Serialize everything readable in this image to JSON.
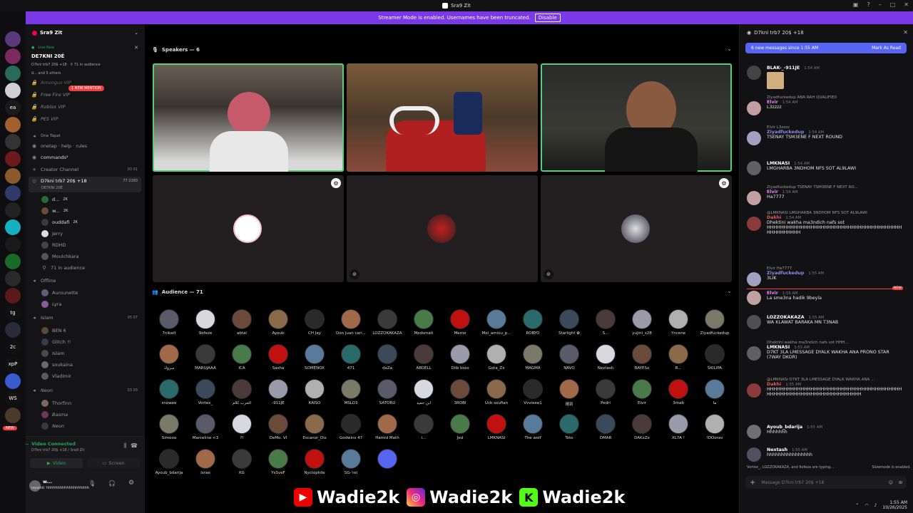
{
  "window": {
    "title": "Sra9 Zit"
  },
  "banner": {
    "text": "Streamer Mode is enabled. Usernames have been truncated.",
    "button": "Disable"
  },
  "servers": {
    "labels": [
      "ea",
      "tg",
      "2c",
      "xpP",
      "WS"
    ],
    "badges": [
      "2",
      "44",
      "32",
      "7",
      "6",
      "1"
    ],
    "new_label": "NEW"
  },
  "sidebar": {
    "server_name": "Sra9 Zit",
    "live_label": "Live Now",
    "live_title": "DE7KNI 20É",
    "live_sub": "D7kni trb7 20$ +18 · ⚲ 71 in audience",
    "live_others": "d... and 5 others",
    "mention_badge": "1 NEW MENTION",
    "channels_top": [
      "Amongus VIP",
      "Free Fire VIP",
      "Roblox VIP",
      "PES VIP"
    ],
    "one_tapat": "One Tapat",
    "onetap": "onetap · help · rules",
    "commands": "commands²",
    "creator_channel": "Creator Channel",
    "creator_count": "00 01",
    "stage_channel": "D7kni trb7 20$ +18",
    "stage_sub": "DE7KNI 20É",
    "stage_stats": "77  2160",
    "stage_users": [
      {
        "name": "d...",
        "badge": "2K"
      },
      {
        "name": "w...",
        "badge": "2K"
      },
      {
        "name": "ouddafi",
        "badge": "2K"
      },
      {
        "name": "Jerry"
      },
      {
        "name": "RDHD"
      },
      {
        "name": "Moulchkara"
      }
    ],
    "audience_count": "71 in audience",
    "offline": "Offline",
    "offline_users": [
      "Aurounette",
      "Lyra"
    ],
    "islam_cat": "Islam",
    "islam_count": "05 07",
    "islam_users": [
      "BEN 6",
      "Glitch !!",
      "Islam",
      "soukaina",
      "Vladimir"
    ],
    "neon_cat": "Neon",
    "neon_count": "03 03",
    "neon_users": [
      "Thorfinn",
      "Basma",
      "Neon"
    ]
  },
  "vc": {
    "status": "Video Connected",
    "sub": "D7kni trb7 20$ +18 / Sra9 Zit",
    "video": "Video",
    "screen": "Screen"
  },
  "user": {
    "name": "w...",
    "status": "izyvoid: hhhhhhhhhhhhhhhhhhh"
  },
  "stage": {
    "speakers_label": "Speakers — 6",
    "audience_label": "Audience — 71"
  },
  "audience": [
    [
      "7nikatt",
      "9ofeze",
      "abtal",
      "Ayoub",
      "CH Jay",
      "Don juan carl...",
      "LOZZOKAKAZA",
      "Medsmati",
      "Memo",
      "Moi_amiou_p...",
      "ROBYO",
      "Starlight ✿",
      "S...",
      "yujini_s28",
      "Yncene",
      "Ziyadfuckedup"
    ],
    [
      "سروك",
      "MARUJAAA",
      "ICA",
      "Sasha",
      "SOMENOX",
      "471",
      "daZa",
      "ABDELL",
      "Diib boss",
      "Gota_Zx",
      "MAGMA",
      "NAVO",
      "Nextash",
      "RAYESx",
      "R...",
      "SKILIPA"
    ],
    [
      "snowee",
      "Vortex_",
      "الحرب كلام",
      "-911JE",
      "KAISO",
      "MSLO3",
      "SATORU",
      "ابن حميد",
      "3ROBI",
      "Ucb soufian",
      "Vvvieee1",
      "晴到",
      "Pedri",
      "Elvir",
      "3mab",
      "ما"
    ],
    [
      "Simooo",
      "Marceline <3",
      "?!",
      "DeMo. VI",
      "Escanor_Dis",
      "Godwins 47",
      "Hamid Math",
      "i...",
      "Jed",
      "LMKNASI",
      "The wolf",
      "Toto",
      "OMAR",
      "DAKxZx",
      "XL7A !",
      "!DOorav"
    ],
    [
      "Ayoub_bdarija",
      "Israe",
      "KG",
      "YsSveF",
      "Nyctophile",
      "SG-'rei",
      ""
    ]
  ],
  "chat": {
    "title": "D7kni trb7 20$ +18",
    "new_messages": "6 new messages since 1:55 AM",
    "mark_read": "Mark As Read",
    "input_placeholder": "Message D7kni trb7 20$ +18",
    "typing": "Vortex_, LOZZOKAKAZA, and 9ofeza are typing...",
    "slowmode": "Slowmode is enabled.",
    "messages": [
      {
        "user": "BLAK-_-911JE",
        "time": "1:54 AM",
        "text": ""
      },
      {
        "reply": "Ziyadfuckedup ANA RAH QUALIFIED",
        "user": "Elvir",
        "time": "1:54 AM",
        "text": "L3zzzz"
      },
      {
        "reply": "Elvir  L3zzzz",
        "user": "Ziyadfuckedup",
        "time": "1:54 AM",
        "text": "TSENAY TSM3ENE F NEXT ROUND"
      },
      {
        "user": "LMKNASI",
        "time": "1:54 AM",
        "text": "LMGHARBA 3NDHOM NFS SOT AL9LAWI"
      },
      {
        "reply": "Ziyadfuckedup TSENAY TSM3ENE F NEXT RO...",
        "user": "Elvir",
        "time": "1:54 AM",
        "text": "Ha7777"
      },
      {
        "reply": "@LMKNASI LMGHARBA 3NDHOM NFS SOT AL9LAWI",
        "user": "Dakhi",
        "time": "1:54 AM",
        "text": "Dhektini wakha ma3ndich nafs sot HHHHHHHHHHHHHHHHHHHHHHHHHHHHHHHHHHHHHHHHHHHHHHHHHH"
      },
      {
        "reply": "Elvir  Ha7777",
        "user": "Ziyadfuckedup",
        "time": "1:55 AM",
        "text": "3LIK"
      },
      {
        "user": "Elvir",
        "time": "1:55 AM",
        "text": "La sme3na hadik 9beyla"
      },
      {
        "user": "LOZZOKAKAZA",
        "time": "1:55 AM",
        "text": "WA KLAWAT BARAKA MN T3NAB"
      },
      {
        "reply": "Dhektini wakha ma3ndich nafs sot HHH...",
        "user": "LMKNASI",
        "time": "1:55 AM",
        "text": "D7KT 3LA LMESSAGE DYALK WAKHA ANA PRONO STAR (7WAY DKOR)"
      },
      {
        "reply": "@LMKNASI D7KT 3LA LMESSAGE DYALK WAKHA ANA ...",
        "user": "Dakhi",
        "time": "1:55 AM",
        "text": "HHHHHHHHHHHHHHHHHHHHHHHHHHHHHHHHHHHHHHHHHHHHHHHHHHHHHHHHHHHHHHHHHHHH"
      },
      {
        "user": "Ayoub_bdarija",
        "time": "1:55 AM",
        "text": "Hhhhhhh"
      },
      {
        "user": "Nextash",
        "time": "1:55 AM",
        "text": "hhhhhhhhhhhhhhhh"
      }
    ],
    "new_tag": "NEW"
  },
  "overlay": {
    "youtube": "Wadie2k",
    "instagram": "Wadie2k",
    "kick": "Wadie2k"
  },
  "taskbar": {
    "time": "1:55 AM",
    "date": "10/26/2025"
  },
  "colors": {
    "accent": "#7b38e6",
    "speaking": "#4fd37a",
    "live": "#23a55a",
    "mention": "#f23f42"
  }
}
